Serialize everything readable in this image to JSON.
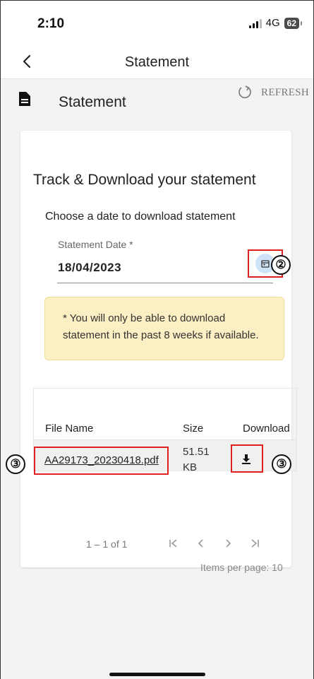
{
  "status_bar": {
    "time": "2:10",
    "network": "4G",
    "battery": "62"
  },
  "nav": {
    "title": "Statement",
    "back_icon": "chevron-left-icon"
  },
  "section": {
    "icon": "document-icon",
    "title": "Statement",
    "refresh_label": "REFRESH",
    "refresh_icon": "refresh-icon"
  },
  "card": {
    "title": "Track & Download your statement",
    "choose_label": "Choose a date to download statement",
    "date_field": {
      "label": "Statement Date *",
      "value": "18/04/2023",
      "icon": "calendar-icon"
    },
    "notice": "* You will only be able to download statement in the past 8 weeks if available."
  },
  "table": {
    "headers": [
      "File Name",
      "Size",
      "Download"
    ],
    "rows": [
      {
        "file_name": "AA29173_20230418.pdf",
        "size": "51.51 KB",
        "download_icon": "download-icon"
      }
    ]
  },
  "pagination": {
    "range": "1 – 1 of 1",
    "items_per_page": "Items per page: 10"
  },
  "annotations": {
    "marker_2": "②",
    "marker_3": "③",
    "highlight_color": "#e02020"
  },
  "colors": {
    "notice_bg": "#fbefc3",
    "header_bg": "#f3f3f3",
    "calendar_bg": "#cfe3f7"
  }
}
